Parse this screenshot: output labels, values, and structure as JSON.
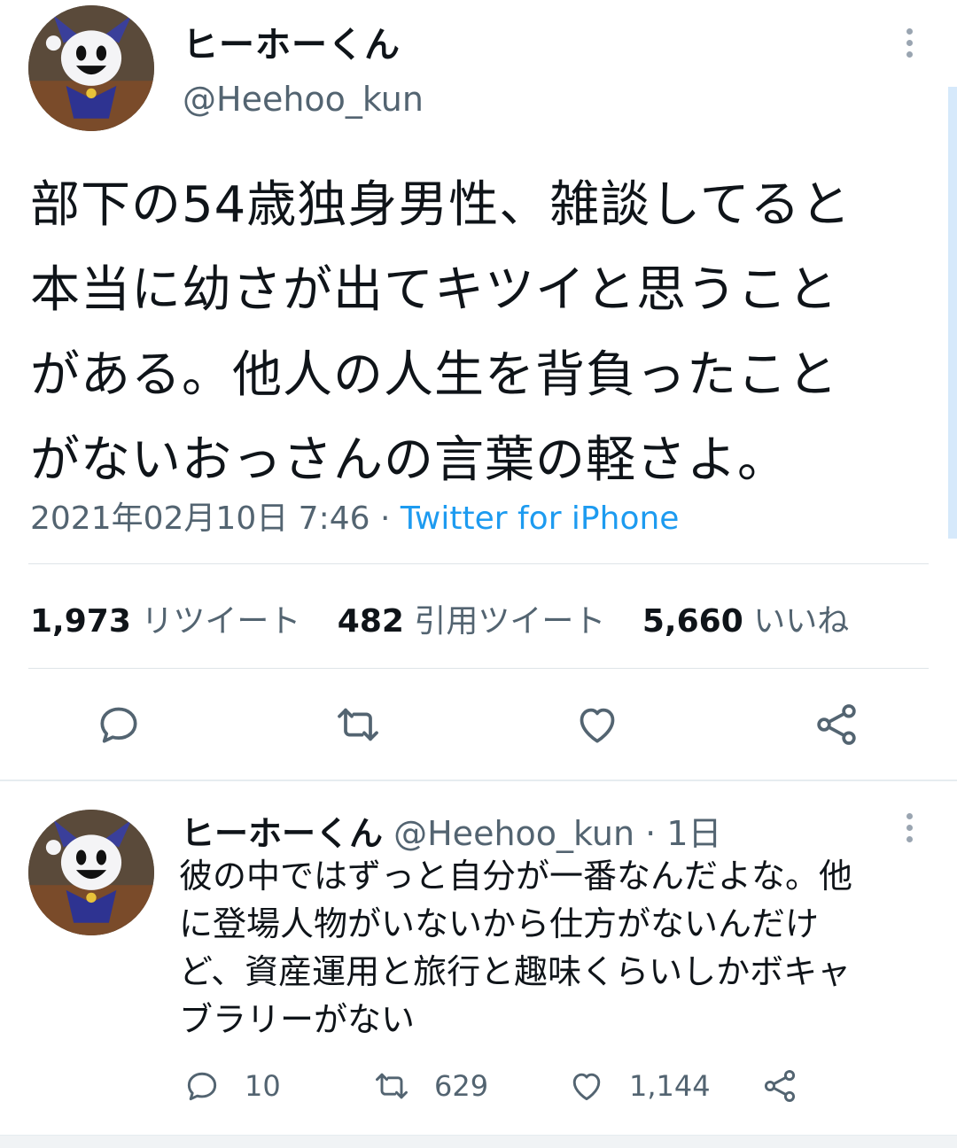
{
  "main_tweet": {
    "author_name": "ヒーホーくん",
    "author_handle": "@Heehoo_kun",
    "text_lines": [
      "部下の54歳独身男性、雑談してると",
      "本当に幼さが出てキツイと思うこと",
      "がある。他人の人生を背負ったこと",
      "がないおっさんの言葉の軽さよ。"
    ],
    "timestamp": "2021年02月10日 7:46",
    "separator": "·",
    "source": "Twitter for iPhone",
    "stats": {
      "retweets_count": "1,973",
      "retweets_label": "リツイート",
      "quotes_count": "482",
      "quotes_label": "引用ツイート",
      "likes_count": "5,660",
      "likes_label": "いいね"
    },
    "actions": [
      "reply-icon",
      "retweet-icon",
      "like-icon",
      "share-icon"
    ]
  },
  "reply_tweet": {
    "author_name": "ヒーホーくん",
    "author_handle": "@Heehoo_kun",
    "separator": "·",
    "time": "1日",
    "text_lines": [
      "彼の中ではずっと自分が一番なんだよな。他",
      "に登場人物がいないから仕方がないんだけ",
      "ど、資産運用と旅行と趣味くらいしかボキャ",
      "ブラリーがない"
    ],
    "reply_count": "10",
    "retweet_count": "629",
    "like_count": "1,144"
  },
  "colors": {
    "text": "#0f1419",
    "secondary": "#536471",
    "link": "#1d9bf0",
    "icon": "#536471"
  }
}
